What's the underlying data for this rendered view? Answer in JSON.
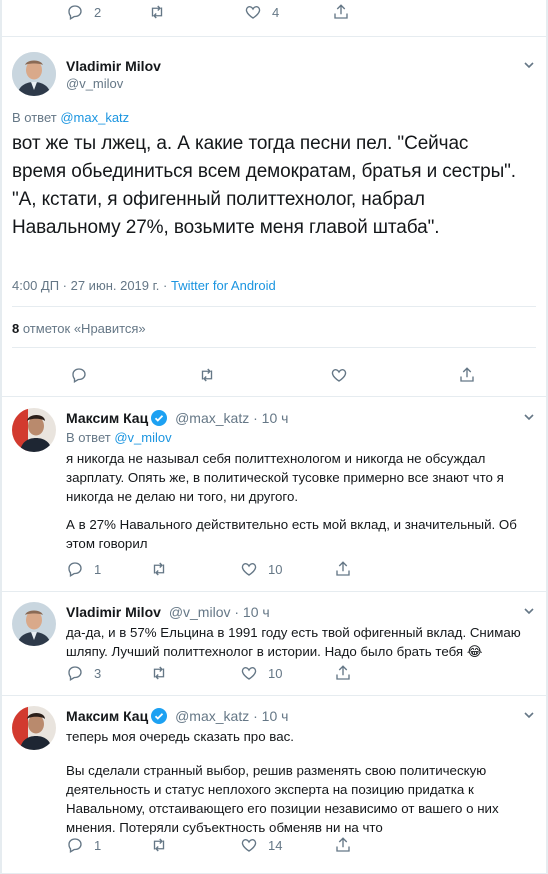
{
  "top_actions": {
    "replies": "2",
    "likes": "4"
  },
  "main_tweet": {
    "name": "Vladimir Milov",
    "handle": "@v_milov",
    "reply_prefix": "В ответ",
    "reply_to": "@max_katz",
    "text": "вот же ты лжец, а. А какие тогда песни пел. \"Сейчас время обьединиться всем демократам, братья и сестры\". \"А, кстати, я офигенный политтехнолог, набрал Навальному 27%, возьмите меня главой штаба\".",
    "timestamp": "4:00 ДП · 27 июн. 2019 г. ·",
    "source": "Twitter for Android",
    "likes_count": "8",
    "likes_label": "отметок «Нравится»"
  },
  "replies": [
    {
      "name": "Максим Кац",
      "verified": true,
      "handle": "@max_katz · 10 ч",
      "reply_prefix": "В ответ",
      "reply_to": "@v_milov",
      "para1": "я никогда не называл себя политтехнологом и никогда не обсуждал зарплату. Опять же, в политической тусовке примерно все знают что я никогда не делаю ни того, ни другого.",
      "para2": "А в 27% Навального действительно есть мой вклад, и значительный. Об этом говорил",
      "replies": "1",
      "retweets": "",
      "likes": "10"
    },
    {
      "name": "Vladimir Milov",
      "verified": false,
      "handle": "@v_milov · 10 ч",
      "para1": "да-да, и в 57% Ельцина в 1991 году есть твой офигенный вклад. Снимаю шляпу. Лучший политтехнолог в истории. Надо было брать тебя 😂",
      "replies": "3",
      "retweets": "",
      "likes": "10"
    },
    {
      "name": "Максим Кац",
      "verified": true,
      "handle": "@max_katz · 10 ч",
      "para1": "теперь моя очередь сказать про вас.",
      "para2": "Вы сделали странный выбор, решив разменять свою политическую деятельность и статус неплохого эксперта на позицию придатка к Навальному, отстаивающего его позиции независимо от вашего о них мнения. Потеряли субъектность обменяв ни на что",
      "replies": "1",
      "retweets": "",
      "likes": "14"
    }
  ],
  "colors": {
    "link": "#1b95e0",
    "muted": "#657786",
    "border": "#e6ecf0",
    "text": "#14171a"
  }
}
